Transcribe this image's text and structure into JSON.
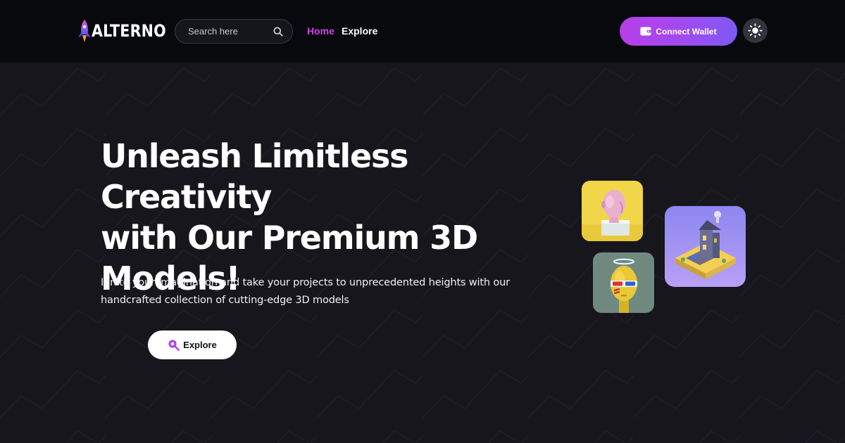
{
  "brand": {
    "name": "ALTERNO"
  },
  "search": {
    "placeholder": "Search here",
    "icon": "search-icon"
  },
  "nav": {
    "items": [
      {
        "label": "Home",
        "active": true
      },
      {
        "label": "Explore",
        "active": false
      }
    ]
  },
  "actions": {
    "connect_wallet_label": "Connect Wallet",
    "wallet_icon": "wallet-icon",
    "theme_icon": "sun-icon"
  },
  "hero": {
    "title_lines": [
      "Unleash Limitless Creativity",
      "with Our Premium 3D",
      "Models!"
    ],
    "subtitle_lines": [
      "Ignite your imagination and take your projects to unprecedented heights with our",
      "handcrafted collection of cutting-edge 3D models"
    ],
    "cta_label": "Explore",
    "cta_icon": "explore-search-icon"
  },
  "colors": {
    "page_background": "#16161c",
    "header_background": "#08090c",
    "accent": "#c943e8",
    "wallet_gradient_start": "#b63fe8",
    "wallet_gradient_end": "#7d5af5",
    "card_yellow": "#f2d64a",
    "card_violet": "#9d8cf2"
  }
}
